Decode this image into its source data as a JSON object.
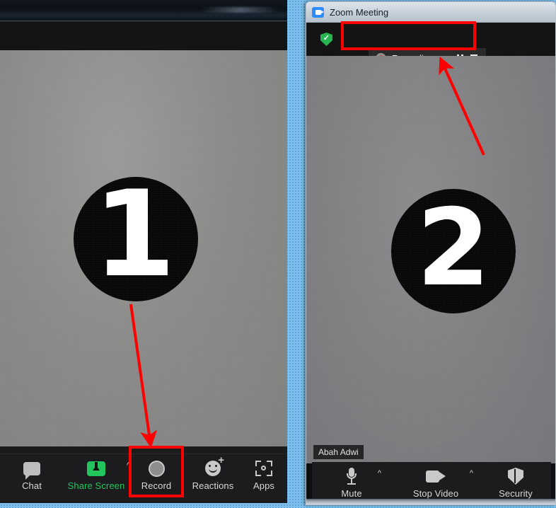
{
  "desktop": {
    "wallpaper_color": "#7dc0ee"
  },
  "annotations": {
    "accent_color": "#ff0000",
    "left_arrow": "arrow pointing down to Record button",
    "right_arrow": "arrow pointing up to Recording indicator",
    "left_box_target": "Record",
    "right_box_target": "Recording..."
  },
  "left_window": {
    "video": {
      "number_label": "1",
      "background_color": "#8b8b8a"
    },
    "toolbar": {
      "items": [
        {
          "label": "Chat",
          "icon": "chat-bubble-icon",
          "has_caret": false,
          "highlighted": false
        },
        {
          "label": "Share Screen",
          "icon": "share-screen-icon",
          "has_caret": true,
          "highlighted": false,
          "color": "#21c45d"
        },
        {
          "label": "Record",
          "icon": "record-circle-icon",
          "has_caret": false,
          "highlighted": true
        },
        {
          "label": "Reactions",
          "icon": "reactions-smiley-icon",
          "has_caret": false,
          "highlighted": false
        },
        {
          "label": "Apps",
          "icon": "apps-icon",
          "has_caret": false,
          "highlighted": false
        }
      ]
    }
  },
  "right_window": {
    "titlebar": {
      "title": "Zoom Meeting",
      "app_icon": "zoom-camera-icon"
    },
    "topbar": {
      "security_shield": "green-shield-check-icon",
      "recording": {
        "status_label": "Recording...",
        "record_dot_color": "#e2473a",
        "pause_button": "pause-icon",
        "stop_button": "stop-icon"
      }
    },
    "video": {
      "number_label": "2",
      "participant_name": "Abah Adwi",
      "background_color": "#807f82"
    },
    "toolbar": {
      "items": [
        {
          "label": "Mute",
          "icon": "microphone-icon",
          "has_caret": true
        },
        {
          "label": "Stop Video",
          "icon": "video-camera-icon",
          "has_caret": true
        },
        {
          "label": "Security",
          "icon": "shield-icon",
          "has_caret": false
        }
      ]
    }
  }
}
